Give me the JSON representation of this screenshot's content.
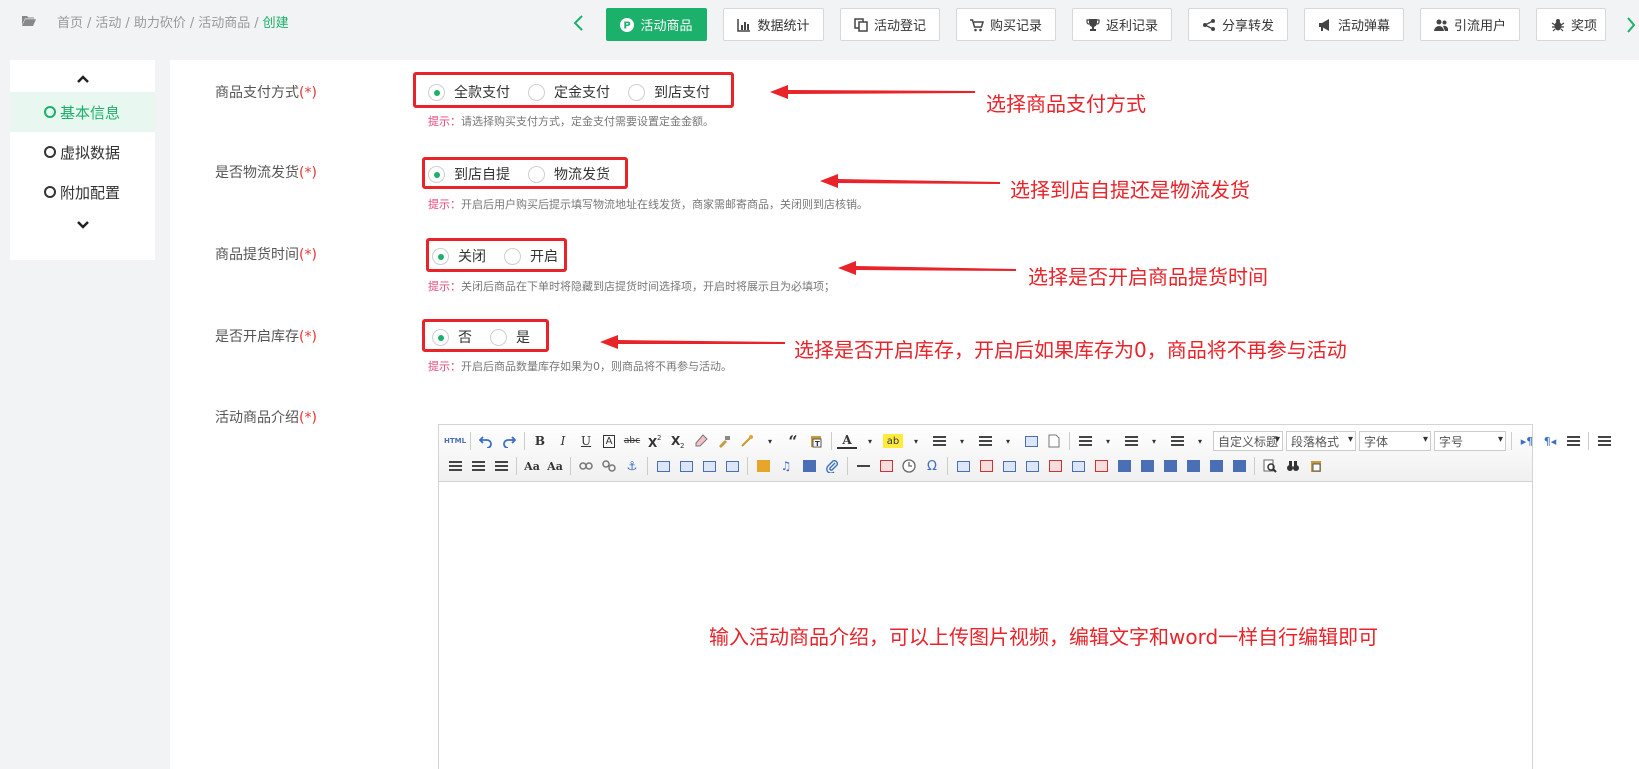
{
  "breadcrumb": {
    "items": [
      "首页",
      "活动",
      "助力砍价",
      "活动商品"
    ],
    "current": "创建",
    "separator": "/"
  },
  "top_tabs": [
    {
      "label": "活动商品",
      "icon": "product-icon",
      "active": true
    },
    {
      "label": "数据统计",
      "icon": "bar-chart-icon"
    },
    {
      "label": "活动登记",
      "icon": "copy-icon"
    },
    {
      "label": "购买记录",
      "icon": "cart-icon"
    },
    {
      "label": "返利记录",
      "icon": "trophy-icon"
    },
    {
      "label": "分享转发",
      "icon": "share-icon"
    },
    {
      "label": "活动弹幕",
      "icon": "megaphone-icon"
    },
    {
      "label": "引流用户",
      "icon": "users-icon"
    },
    {
      "label": "奖项",
      "icon": "bug-icon"
    }
  ],
  "sidenav": {
    "items": [
      {
        "label": "基本信息",
        "active": true
      },
      {
        "label": "虚拟数据"
      },
      {
        "label": "附加配置"
      }
    ]
  },
  "form": {
    "payment": {
      "label": "商品支付方式",
      "required_mark": "(*)",
      "options": [
        "全款支付",
        "定金支付",
        "到店支付"
      ],
      "selected": "全款支付",
      "hint_key": "提示：",
      "hint": "请选择购买支付方式，定金支付需要设置定金金额。",
      "annotation": "选择商品支付方式"
    },
    "logistics": {
      "label": "是否物流发货",
      "required_mark": "(*)",
      "options": [
        "到店自提",
        "物流发货"
      ],
      "selected": "到店自提",
      "hint_key": "提示：",
      "hint": "开启后用户购买后提示填写物流地址在线发货，商家需邮寄商品，关闭则到店核销。",
      "annotation": "选择到店自提还是物流发货"
    },
    "pickup_time": {
      "label": "商品提货时间",
      "required_mark": "(*)",
      "options": [
        "关闭",
        "开启"
      ],
      "selected": "关闭",
      "hint_key": "提示：",
      "hint": "关闭后商品在下单时将隐藏到店提货时间选择项，开启时将展示且为必填项；",
      "annotation": "选择是否开启商品提货时间"
    },
    "stock": {
      "label": "是否开启库存",
      "required_mark": "(*)",
      "options": [
        "否",
        "是"
      ],
      "selected": "否",
      "hint_key": "提示：",
      "hint": "开启后商品数量库存如果为0，则商品将不再参与活动。",
      "annotation": "选择是否开启库存，开启后如果库存为0，商品将不再参与活动"
    },
    "intro": {
      "label": "活动商品介绍",
      "required_mark": "(*)",
      "annotation": "输入活动商品介绍，可以上传图片视频，编辑文字和word一样自行编辑即可"
    }
  },
  "editor": {
    "html_label": "HTML",
    "selects": [
      "自定义标题",
      "段落格式",
      "字体",
      "字号"
    ]
  },
  "colors": {
    "accent": "#1cb16b",
    "annotation": "#e8232a",
    "hint_key": "#e5467c"
  }
}
